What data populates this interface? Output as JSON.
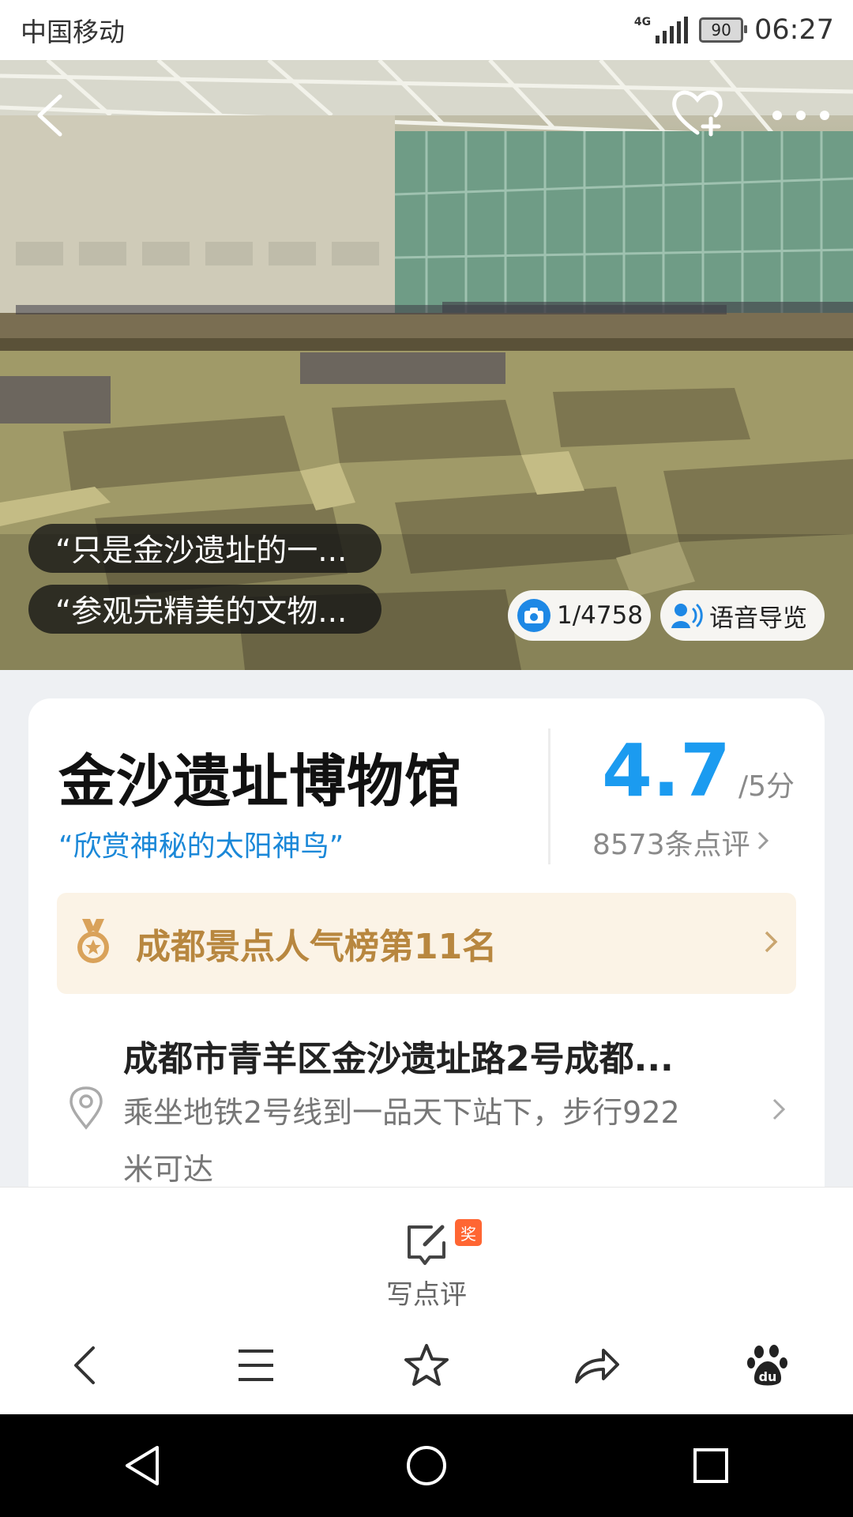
{
  "status_bar": {
    "carrier": "中国移动",
    "network": "4G",
    "battery": "90",
    "time": "06:27"
  },
  "hero": {
    "quotes": [
      "“只是金沙遗址的一...",
      "“参观完精美的文物..."
    ],
    "photo_counter": "1/4758",
    "voice_guide_label": "语音导览",
    "icons": [
      "back-arrow-icon",
      "favorite-heart-plus-icon",
      "more-dots-icon",
      "camera-icon",
      "headset-audio-icon"
    ]
  },
  "attraction": {
    "name": "金沙遗址博物馆",
    "slogan": "“欣赏神秘的太阳神鸟”",
    "rating": "4.7",
    "rating_unit": "/5分",
    "review_count": "8573条点评",
    "rank": "成都景点人气榜第11名",
    "address": "成都市青羊区金沙遗址路2号成都...",
    "directions": "乘坐地铁2号线到一品天下站下，步行922米可达"
  },
  "review_bar": {
    "write_label": "写点评",
    "badge": "奖"
  },
  "browser_toolbar": [
    "back-icon",
    "menu-icon",
    "star-icon",
    "share-icon",
    "baidu-paw-icon"
  ],
  "colors": {
    "accent_blue": "#1b9bf0",
    "rank_gold": "#b8873f",
    "rank_bg": "#fbf3e6",
    "badge_orange": "#ff6633"
  }
}
